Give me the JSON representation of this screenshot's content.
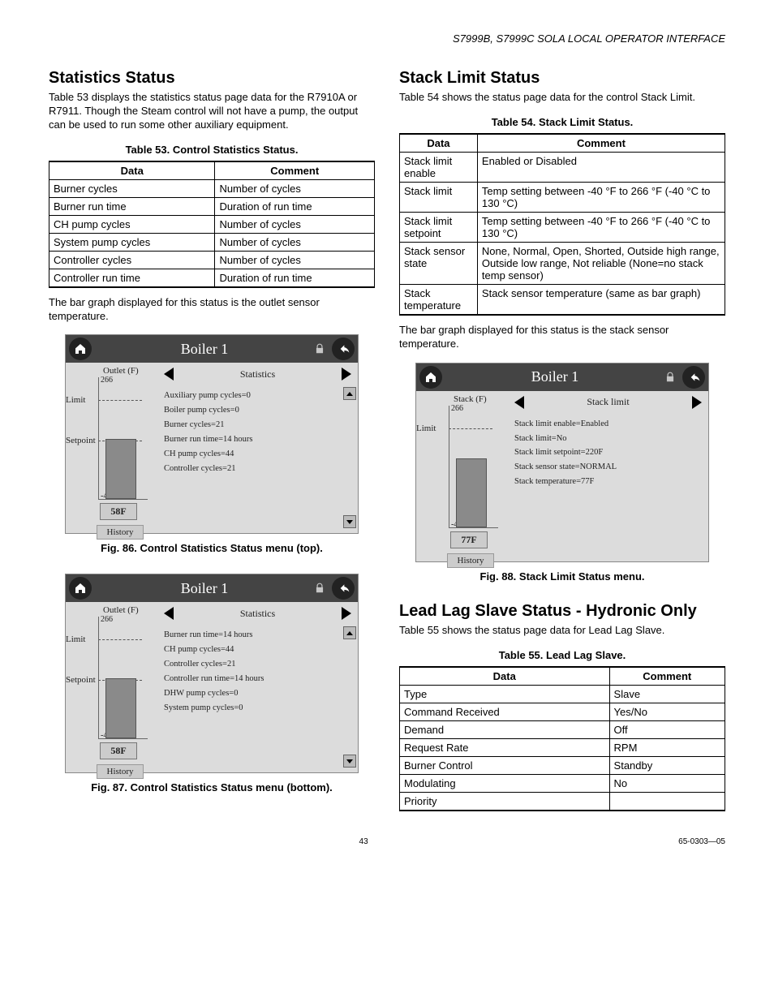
{
  "header": "S7999B, S7999C SOLA LOCAL OPERATOR INTERFACE",
  "left": {
    "heading": "Statistics Status",
    "intro": "Table 53 displays the statistics status page data for the R7910A or R7911. Though the Steam control will not have a pump, the output can be used to run some other auxiliary equipment.",
    "table_caption": "Table 53. Control Statistics Status.",
    "table_head": {
      "c1": "Data",
      "c2": "Comment"
    },
    "rows": [
      {
        "c1": "Burner cycles",
        "c2": "Number of cycles"
      },
      {
        "c1": "Burner run time",
        "c2": "Duration of run time"
      },
      {
        "c1": "CH pump cycles",
        "c2": "Number of cycles"
      },
      {
        "c1": "System pump cycles",
        "c2": "Number of cycles"
      },
      {
        "c1": "Controller cycles",
        "c2": "Number of cycles"
      },
      {
        "c1": "Controller run time",
        "c2": "Duration of run time"
      }
    ],
    "after": "The bar graph displayed for this status is the outlet sensor temperature.",
    "fig86": {
      "caption": "Fig. 86. Control Statistics Status menu (top).",
      "title": "Boiler 1",
      "axis": "Outlet (F)",
      "top_tick": "266",
      "bot_tick": "-40",
      "limit": "Limit",
      "setpoint": "Setpoint",
      "temp": "58F",
      "history": "History",
      "nav": "Statistics",
      "lines": [
        "Auxiliary pump cycles=0",
        "Boiler pump cycles=0",
        "Burner cycles=21",
        "Burner run time=14 hours",
        "CH pump cycles=44",
        "Controller cycles=21"
      ]
    },
    "fig87": {
      "caption": "Fig. 87. Control Statistics Status menu (bottom).",
      "title": "Boiler 1",
      "axis": "Outlet (F)",
      "top_tick": "266",
      "bot_tick": "-40",
      "limit": "Limit",
      "setpoint": "Setpoint",
      "temp": "58F",
      "history": "History",
      "nav": "Statistics",
      "lines": [
        "Burner run time=14 hours",
        "CH pump cycles=44",
        "Controller cycles=21",
        "Controller run time=14 hours",
        "DHW pump cycles=0",
        "System pump cycles=0"
      ]
    }
  },
  "right": {
    "heading": "Stack Limit Status",
    "intro": "Table 54 shows the status page data for the control Stack Limit.",
    "table_caption": "Table 54. Stack Limit Status.",
    "table_head": {
      "c1": "Data",
      "c2": "Comment"
    },
    "rows": [
      {
        "c1": "Stack limit enable",
        "c2": "Enabled or Disabled"
      },
      {
        "c1": "Stack limit",
        "c2": "Temp setting between -40 °F to 266 °F (-40 °C to 130 °C)"
      },
      {
        "c1": "Stack limit setpoint",
        "c2": "Temp setting between -40 °F to 266 °F (-40 °C to 130 °C)"
      },
      {
        "c1": "Stack sensor state",
        "c2": "None, Normal, Open, Shorted, Outside high range, Outside low range, Not reliable (None=no stack temp sensor)"
      },
      {
        "c1": "Stack temperature",
        "c2": "Stack sensor temperature (same as bar graph)"
      }
    ],
    "after": "The bar graph displayed for this status is the stack sensor temperature.",
    "fig88": {
      "caption": "Fig. 88. Stack Limit Status menu.",
      "title": "Boiler 1",
      "axis": "Stack (F)",
      "top_tick": "266",
      "bot_tick": "-40",
      "limit": "Limit",
      "temp": "77F",
      "history": "History",
      "nav": "Stack limit",
      "lines": [
        "Stack limit enable=Enabled",
        "Stack limit=No",
        "Stack limit setpoint=220F",
        "Stack sensor state=NORMAL",
        "Stack temperature=77F"
      ]
    },
    "heading2": "Lead Lag Slave Status - Hydronic Only",
    "intro2": "Table 55 shows the status page data for Lead Lag Slave.",
    "table55_caption": "Table 55. Lead Lag Slave.",
    "table55_head": {
      "c1": "Data",
      "c2": "Comment"
    },
    "rows55": [
      {
        "c1": "Type",
        "c2": "Slave"
      },
      {
        "c1": "Command Received",
        "c2": "Yes/No"
      },
      {
        "c1": "Demand",
        "c2": "Off"
      },
      {
        "c1": "Request Rate",
        "c2": "RPM"
      },
      {
        "c1": "Burner Control",
        "c2": "Standby"
      },
      {
        "c1": "Modulating",
        "c2": "No"
      },
      {
        "c1": "Priority",
        "c2": ""
      }
    ]
  },
  "footer": {
    "page": "43",
    "doc": "65-0303—05"
  }
}
